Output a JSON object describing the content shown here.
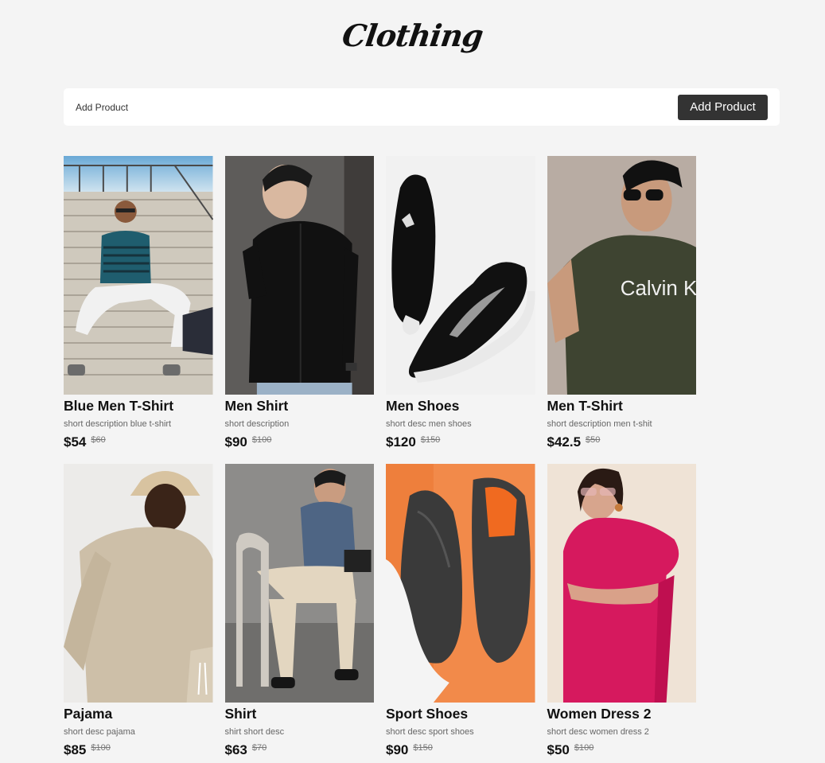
{
  "header": {
    "logo_text": "Clothing"
  },
  "add_bar": {
    "label": "Add Product",
    "button_label": "Add Product"
  },
  "products": [
    {
      "name": "Blue Men T-Shirt",
      "description": "short description blue t-shirt",
      "price": "$54",
      "old_price": "$60",
      "image": "man-sitting-on-stairs-photo"
    },
    {
      "name": "Men Shirt",
      "description": "short description",
      "price": "$90",
      "old_price": "$100",
      "image": "man-in-black-shirt-photo"
    },
    {
      "name": "Men Shoes",
      "description": "short desc men shoes",
      "price": "$120",
      "old_price": "$150",
      "image": "black-sneakers-photo"
    },
    {
      "name": "Men T-Shirt",
      "description": "short description men t-shit",
      "price": "$42.5",
      "old_price": "$50",
      "image": "man-in-olive-tshirt-photo",
      "image_text": "Calvin Kle"
    },
    {
      "name": "Pajama",
      "description": "short desc pajama",
      "price": "$85",
      "old_price": "$100",
      "image": "man-in-beige-sweatshirt-photo"
    },
    {
      "name": "Shirt",
      "description": "shirt short desc",
      "price": "$63",
      "old_price": "$70",
      "image": "man-seated-on-chair-photo"
    },
    {
      "name": "Sport Shoes",
      "description": "short desc sport shoes",
      "price": "$90",
      "old_price": "$150",
      "image": "sport-shoes-on-orange-photo"
    },
    {
      "name": "Women Dress 2",
      "description": "short desc women dress 2",
      "price": "$50",
      "old_price": "$100",
      "image": "woman-in-pink-dress-photo"
    }
  ]
}
